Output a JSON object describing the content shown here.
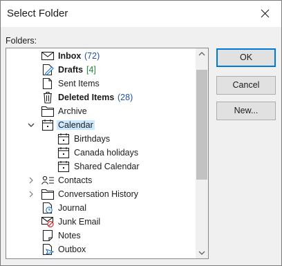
{
  "window": {
    "title": "Select Folder"
  },
  "folders_label": "Folders:",
  "tree": [
    {
      "label": "Inbox",
      "count": "(72)",
      "count_color": "blue",
      "bold": true,
      "icon": "inbox-icon",
      "expander": "none",
      "depth": 1
    },
    {
      "label": "Drafts",
      "count": "[4]",
      "count_color": "green",
      "bold": true,
      "icon": "drafts-icon",
      "expander": "none",
      "depth": 1
    },
    {
      "label": "Sent Items",
      "count": "",
      "bold": false,
      "icon": "sent-items-icon",
      "expander": "none",
      "depth": 1
    },
    {
      "label": "Deleted Items",
      "count": "(28)",
      "count_color": "blue",
      "bold": true,
      "icon": "trash-icon",
      "expander": "none",
      "depth": 1
    },
    {
      "label": "Archive",
      "count": "",
      "bold": false,
      "icon": "folder-icon",
      "expander": "none",
      "depth": 1
    },
    {
      "label": "Calendar",
      "count": "",
      "bold": false,
      "icon": "calendar-icon",
      "expander": "expanded",
      "depth": 1,
      "selected": true
    },
    {
      "label": "Birthdays",
      "count": "",
      "bold": false,
      "icon": "calendar-icon",
      "expander": "none",
      "depth": 2
    },
    {
      "label": "Canada holidays",
      "count": "",
      "bold": false,
      "icon": "calendar-icon",
      "expander": "none",
      "depth": 2
    },
    {
      "label": "Shared Calendar",
      "count": "",
      "bold": false,
      "icon": "calendar-icon",
      "expander": "none",
      "depth": 2
    },
    {
      "label": "Contacts",
      "count": "",
      "bold": false,
      "icon": "contacts-icon",
      "expander": "collapsed",
      "depth": 1
    },
    {
      "label": "Conversation History",
      "count": "",
      "bold": false,
      "icon": "folder-icon",
      "expander": "collapsed",
      "depth": 1
    },
    {
      "label": "Journal",
      "count": "",
      "bold": false,
      "icon": "journal-icon",
      "expander": "none",
      "depth": 1
    },
    {
      "label": "Junk Email",
      "count": "",
      "bold": false,
      "icon": "junk-email-icon",
      "expander": "none",
      "depth": 1
    },
    {
      "label": "Notes",
      "count": "",
      "bold": false,
      "icon": "notes-icon",
      "expander": "none",
      "depth": 1
    },
    {
      "label": "Outbox",
      "count": "",
      "bold": false,
      "icon": "outbox-icon",
      "expander": "none",
      "depth": 1
    }
  ],
  "buttons": {
    "ok": "OK",
    "cancel": "Cancel",
    "new": "New..."
  },
  "colors": {
    "selection": "#cce8ff",
    "count_blue": "#1f4ea1",
    "count_green": "#20813a",
    "default_button_border": "#0078d7"
  }
}
